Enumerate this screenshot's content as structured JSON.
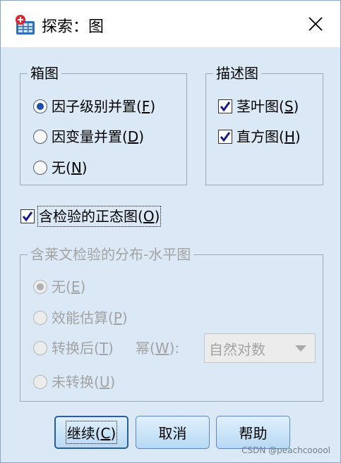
{
  "window": {
    "title": "探索：图",
    "close_icon": "close-icon"
  },
  "boxplot_group": {
    "legend": "箱图",
    "options": [
      {
        "text": "因子级别并置(",
        "key": "F",
        "suffix": ")",
        "selected": true
      },
      {
        "text": "因变量并置(",
        "key": "D",
        "suffix": ")",
        "selected": false
      },
      {
        "text": "无(",
        "key": "N",
        "suffix": ")",
        "selected": false
      }
    ]
  },
  "descriptive_group": {
    "legend": "描述图",
    "options": [
      {
        "text": "茎叶图(",
        "key": "S",
        "suffix": ")",
        "checked": true
      },
      {
        "text": "直方图(",
        "key": "H",
        "suffix": ")",
        "checked": true
      }
    ]
  },
  "normality": {
    "text": "含检验的正态图(",
    "key": "O",
    "suffix": ")",
    "checked": true
  },
  "levene_group": {
    "legend": "含莱文检验的分布-水平图",
    "enabled": false,
    "options": [
      {
        "text": "无(",
        "key": "E",
        "suffix": ")",
        "selected": true
      },
      {
        "text": "效能估算(",
        "key": "P",
        "suffix": ")",
        "selected": false
      },
      {
        "text": "转换后(",
        "key": "T",
        "suffix": ")",
        "selected": false
      },
      {
        "text": "未转换(",
        "key": "U",
        "suffix": ")",
        "selected": false
      }
    ],
    "power_label": {
      "text": "幂(",
      "key": "W",
      "suffix": "):"
    },
    "power_select": {
      "value": "自然对数"
    }
  },
  "buttons": {
    "continue": {
      "text": "继续(",
      "key": "C",
      "suffix": ")"
    },
    "cancel": "取消",
    "help": "帮助"
  },
  "watermark": "CSDN @peachcooool",
  "colors": {
    "dialog_bg": "#dbe8f5",
    "radio_dot": "#1b4fa8",
    "check_mark": "#1a1a8c",
    "disabled_text": "#a3a3a3"
  }
}
